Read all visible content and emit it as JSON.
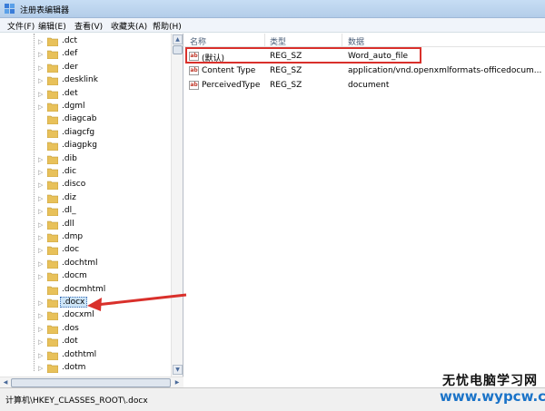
{
  "window": {
    "title": "注册表编辑器"
  },
  "menu": [
    "文件(F)",
    "编辑(E)",
    "查看(V)",
    "收藏夹(A)",
    "帮助(H)"
  ],
  "tree": {
    "items": [
      ".dct",
      ".def",
      ".der",
      ".desklink",
      ".det",
      ".dgml",
      ".diagcab",
      ".diagcfg",
      ".diagpkg",
      ".dib",
      ".dic",
      ".disco",
      ".diz",
      ".dl_",
      ".dll",
      ".dmp",
      ".doc",
      ".dochtml",
      ".docm",
      ".docmhtml",
      ".docx",
      ".docxml",
      ".dos",
      ".dot",
      ".dothtml",
      ".dotm"
    ],
    "expandable": [
      true,
      true,
      true,
      true,
      true,
      true,
      false,
      false,
      false,
      true,
      true,
      true,
      true,
      true,
      true,
      true,
      true,
      true,
      true,
      false,
      true,
      true,
      true,
      true,
      true,
      true
    ],
    "selected": ".docx"
  },
  "values": {
    "columns": [
      "名称",
      "类型",
      "数据"
    ],
    "rows": [
      {
        "name": "(默认)",
        "type": "REG_SZ",
        "data": "Word_auto_file"
      },
      {
        "name": "Content Type",
        "type": "REG_SZ",
        "data": "application/vnd.openxmlformats-officedocum..."
      },
      {
        "name": "PerceivedType",
        "type": "REG_SZ",
        "data": "document"
      }
    ]
  },
  "status": {
    "path": "计算机\\HKEY_CLASSES_ROOT\\.docx"
  },
  "watermark": {
    "cn": "无忧电脑学习网",
    "url": "www.wypcw.com"
  },
  "colors": {
    "annotation": "#d9302b",
    "folder": "#e8c15a",
    "titlebar": "#c7ddf4"
  }
}
